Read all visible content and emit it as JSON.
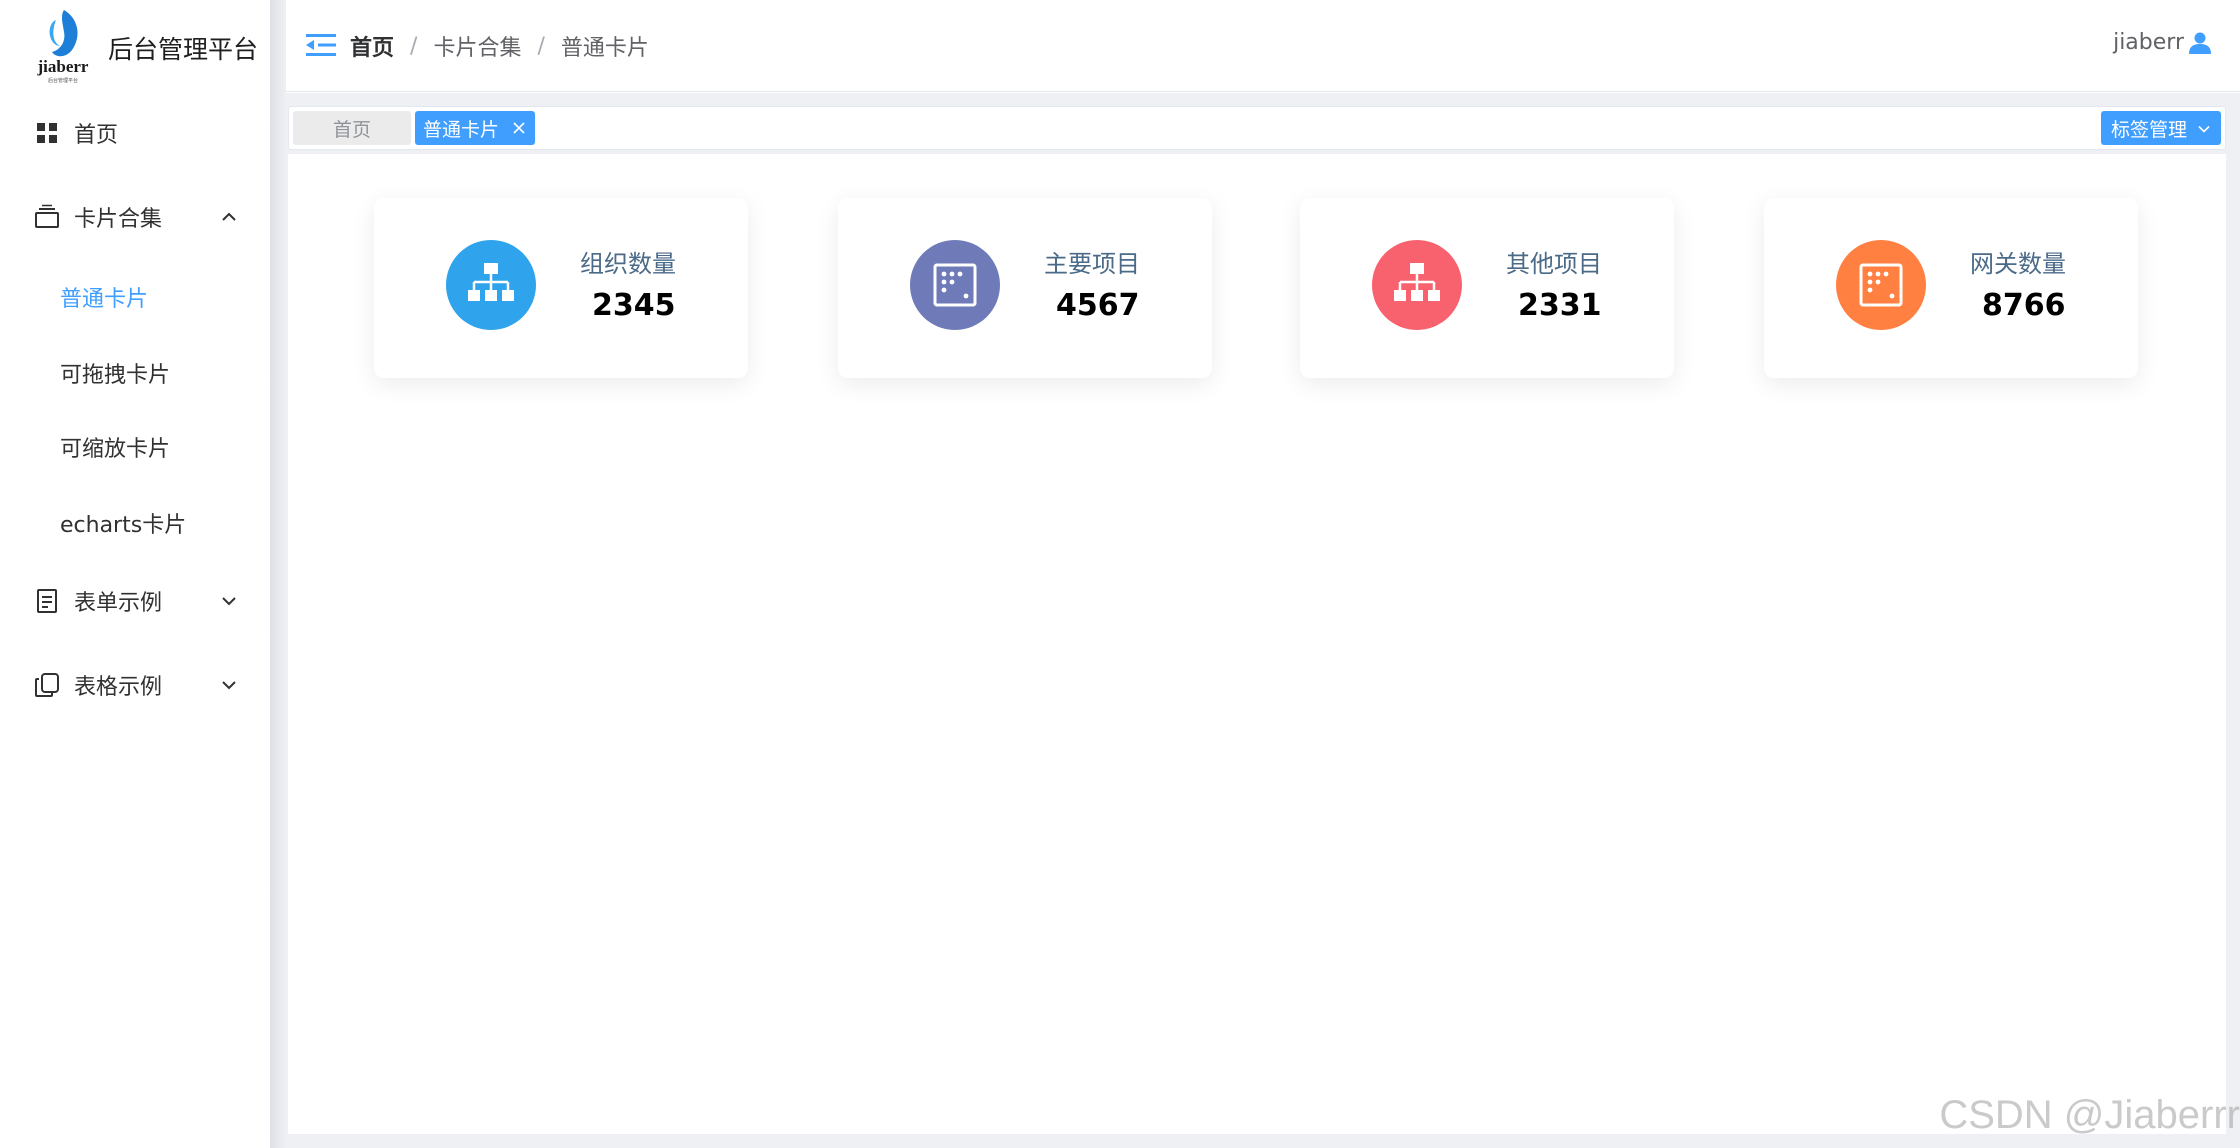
{
  "app": {
    "title": "后台管理平台",
    "logo_text": "jiaberr"
  },
  "colors": {
    "accent": "#409eff",
    "card1": "#2fa3ec",
    "card2": "#6e7bb8",
    "card3": "#f8626e",
    "card4": "#ff8040"
  },
  "sidebar": {
    "items": [
      {
        "label": "首页",
        "icon": "dashboard-grid-icon"
      },
      {
        "label": "卡片合集",
        "icon": "card-stack-icon",
        "expanded": true
      },
      {
        "label": "表单示例",
        "icon": "document-icon",
        "expanded": false
      },
      {
        "label": "表格示例",
        "icon": "copy-icon",
        "expanded": false
      }
    ],
    "sub_items": [
      {
        "label": "普通卡片",
        "active": true
      },
      {
        "label": "可拖拽卡片"
      },
      {
        "label": "可缩放卡片"
      },
      {
        "label": "echarts卡片"
      }
    ]
  },
  "header": {
    "breadcrumb": [
      "首页",
      "卡片合集",
      "普通卡片"
    ],
    "separator": "/",
    "user": "jiaberr"
  },
  "tags": {
    "home": "首页",
    "active": "普通卡片",
    "manage": "标签管理"
  },
  "cards": [
    {
      "label": "组织数量",
      "value": "2345",
      "icon": "org-chart-icon"
    },
    {
      "label": "主要项目",
      "value": "4567",
      "icon": "dot-square-icon"
    },
    {
      "label": "其他项目",
      "value": "2331",
      "icon": "org-chart-icon"
    },
    {
      "label": "网关数量",
      "value": "8766",
      "icon": "dot-square-icon"
    }
  ],
  "watermark": "CSDN @Jiaberrr"
}
